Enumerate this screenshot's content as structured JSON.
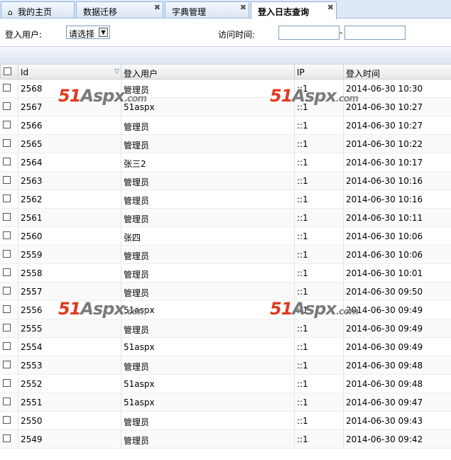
{
  "tabs": [
    {
      "label": "我的主页",
      "closable": false,
      "icon": "home-icon",
      "active": false
    },
    {
      "label": "数据迁移",
      "closable": true,
      "active": false
    },
    {
      "label": "字典管理",
      "closable": true,
      "active": false
    },
    {
      "label": "登入日志查询",
      "closable": true,
      "active": true
    }
  ],
  "filter": {
    "user_label": "登入用户:",
    "user_select": "请选择",
    "time_label": "访问时间:",
    "time_sep": "-"
  },
  "columns": [
    "Id",
    "登入用户",
    "IP",
    "登入时间"
  ],
  "rows": [
    {
      "id": "2568",
      "user": "管理员",
      "ip": "::1",
      "time": "2014-06-30 10:30"
    },
    {
      "id": "2567",
      "user": "51aspx",
      "ip": "::1",
      "time": "2014-06-30 10:27"
    },
    {
      "id": "2566",
      "user": "管理员",
      "ip": "::1",
      "time": "2014-06-30 10:27"
    },
    {
      "id": "2565",
      "user": "管理员",
      "ip": "::1",
      "time": "2014-06-30 10:22"
    },
    {
      "id": "2564",
      "user": "张三2",
      "ip": "::1",
      "time": "2014-06-30 10:17"
    },
    {
      "id": "2563",
      "user": "管理员",
      "ip": "::1",
      "time": "2014-06-30 10:16"
    },
    {
      "id": "2562",
      "user": "管理员",
      "ip": "::1",
      "time": "2014-06-30 10:16"
    },
    {
      "id": "2561",
      "user": "管理员",
      "ip": "::1",
      "time": "2014-06-30 10:11"
    },
    {
      "id": "2560",
      "user": "张四",
      "ip": "::1",
      "time": "2014-06-30 10:06"
    },
    {
      "id": "2559",
      "user": "管理员",
      "ip": "::1",
      "time": "2014-06-30 10:06"
    },
    {
      "id": "2558",
      "user": "管理员",
      "ip": "::1",
      "time": "2014-06-30 10:01"
    },
    {
      "id": "2557",
      "user": "管理员",
      "ip": "::1",
      "time": "2014-06-30 09:50"
    },
    {
      "id": "2556",
      "user": "51aspx",
      "ip": "::1",
      "time": "2014-06-30 09:49"
    },
    {
      "id": "2555",
      "user": "管理员",
      "ip": "::1",
      "time": "2014-06-30 09:49"
    },
    {
      "id": "2554",
      "user": "51aspx",
      "ip": "::1",
      "time": "2014-06-30 09:49"
    },
    {
      "id": "2553",
      "user": "管理员",
      "ip": "::1",
      "time": "2014-06-30 09:48"
    },
    {
      "id": "2552",
      "user": "51aspx",
      "ip": "::1",
      "time": "2014-06-30 09:48"
    },
    {
      "id": "2551",
      "user": "51aspx",
      "ip": "::1",
      "time": "2014-06-30 09:47"
    },
    {
      "id": "2550",
      "user": "管理员",
      "ip": "::1",
      "time": "2014-06-30 09:43"
    },
    {
      "id": "2549",
      "user": "管理员",
      "ip": "::1",
      "time": "2014-06-30 09:42"
    }
  ],
  "watermark": {
    "num": "51",
    "name": "Aspx",
    "domain": ".com"
  }
}
